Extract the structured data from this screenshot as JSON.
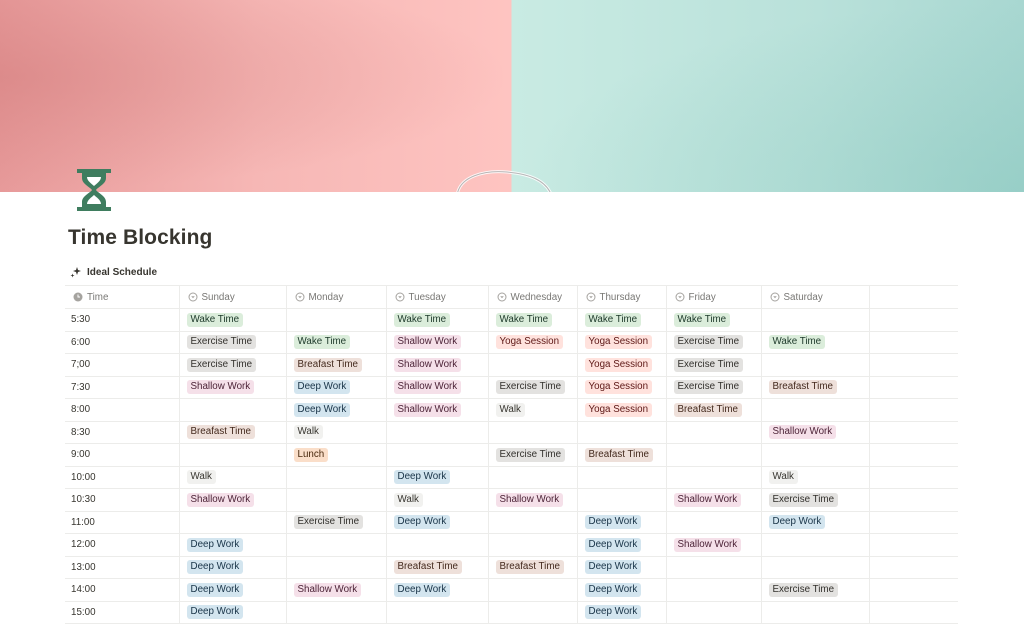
{
  "page": {
    "title": "Time Blocking",
    "icon": "hourglass-icon",
    "view_name": "Ideal Schedule"
  },
  "colors": {
    "cover_left": "#fec4c1",
    "cover_right": "#c9ebe3",
    "icon_green": "#3f7d5f"
  },
  "table": {
    "headers": [
      {
        "label": "Time",
        "icon": "clock-icon"
      },
      {
        "label": "Sunday",
        "icon": "select-icon"
      },
      {
        "label": "Monday",
        "icon": "select-icon"
      },
      {
        "label": "Tuesday",
        "icon": "select-icon"
      },
      {
        "label": "Wednesday",
        "icon": "select-icon"
      },
      {
        "label": "Thursday",
        "icon": "select-icon"
      },
      {
        "label": "Friday",
        "icon": "select-icon"
      },
      {
        "label": "Saturday",
        "icon": "select-icon"
      }
    ],
    "tag_colors": {
      "Wake Time": "green",
      "Exercise Time": "gray",
      "Shallow Work": "pink",
      "Yoga Session": "red",
      "Breafast Time": "brown",
      "Deep Work": "blue",
      "Walk": "light",
      "Lunch": "orange"
    },
    "rows": [
      [
        "5:30",
        "Wake Time",
        "",
        "Wake Time",
        "Wake Time",
        "Wake Time",
        "Wake Time",
        ""
      ],
      [
        "6:00",
        "Exercise Time",
        "Wake Time",
        "Shallow Work",
        "Yoga Session",
        "Yoga Session",
        "Exercise Time",
        "Wake Time"
      ],
      [
        "7;00",
        "Exercise Time",
        "Breafast Time",
        "Shallow Work",
        "",
        "Yoga Session",
        "Exercise Time",
        ""
      ],
      [
        "7:30",
        "Shallow Work",
        "Deep Work",
        "Shallow Work",
        "Exercise Time",
        "Yoga Session",
        "Exercise Time",
        "Breafast Time"
      ],
      [
        "8:00",
        "",
        "Deep Work",
        "Shallow Work",
        "Walk",
        "Yoga Session",
        "Breafast Time",
        ""
      ],
      [
        "8:30",
        "Breafast Time",
        "Walk",
        "",
        "",
        "",
        "",
        "Shallow Work"
      ],
      [
        "9:00",
        "",
        "Lunch",
        "",
        "Exercise Time",
        "Breafast Time",
        "",
        ""
      ],
      [
        "10:00",
        "Walk",
        "",
        "Deep Work",
        "",
        "",
        "",
        "Walk"
      ],
      [
        "10:30",
        "Shallow Work",
        "",
        "Walk",
        "Shallow Work",
        "",
        "Shallow Work",
        "Exercise Time"
      ],
      [
        "11:00",
        "",
        "Exercise Time",
        "Deep Work",
        "",
        "Deep Work",
        "",
        "Deep Work"
      ],
      [
        "12:00",
        "Deep Work",
        "",
        "",
        "",
        "Deep Work",
        "Shallow Work",
        ""
      ],
      [
        "13:00",
        "Deep Work",
        "",
        "Breafast Time",
        "Breafast Time",
        "Deep Work",
        "",
        ""
      ],
      [
        "14:00",
        "Deep Work",
        "Shallow Work",
        "Deep Work",
        "",
        "Deep Work",
        "",
        "Exercise Time"
      ],
      [
        "15:00",
        "Deep Work",
        "",
        "",
        "",
        "Deep Work",
        "",
        ""
      ]
    ]
  }
}
